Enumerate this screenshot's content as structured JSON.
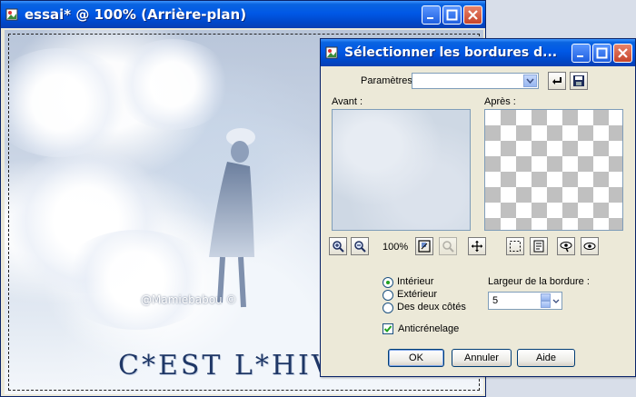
{
  "main_window": {
    "title": "essai* @  100% (Arrière-plan)",
    "watermark": "@Mamiebabou ©",
    "caption": "C*EST L*HIVE"
  },
  "dialog": {
    "title": "Sélectionner les bordures d...",
    "params_label": "Paramètres :",
    "params_value": "",
    "before_label": "Avant :",
    "after_label": "Après :",
    "zoom_level": "100%",
    "options": {
      "interieur": "Intérieur",
      "exterieur": "Extérieur",
      "deux_cotes": "Des deux côtés",
      "selected": "interieur"
    },
    "border_width_label": "Largeur de la bordure :",
    "border_width_value": "5",
    "antialias_label": "Anticrénelage",
    "antialias_checked": true,
    "ok_label": "OK",
    "cancel_label": "Annuler",
    "help_label": "Aide"
  }
}
